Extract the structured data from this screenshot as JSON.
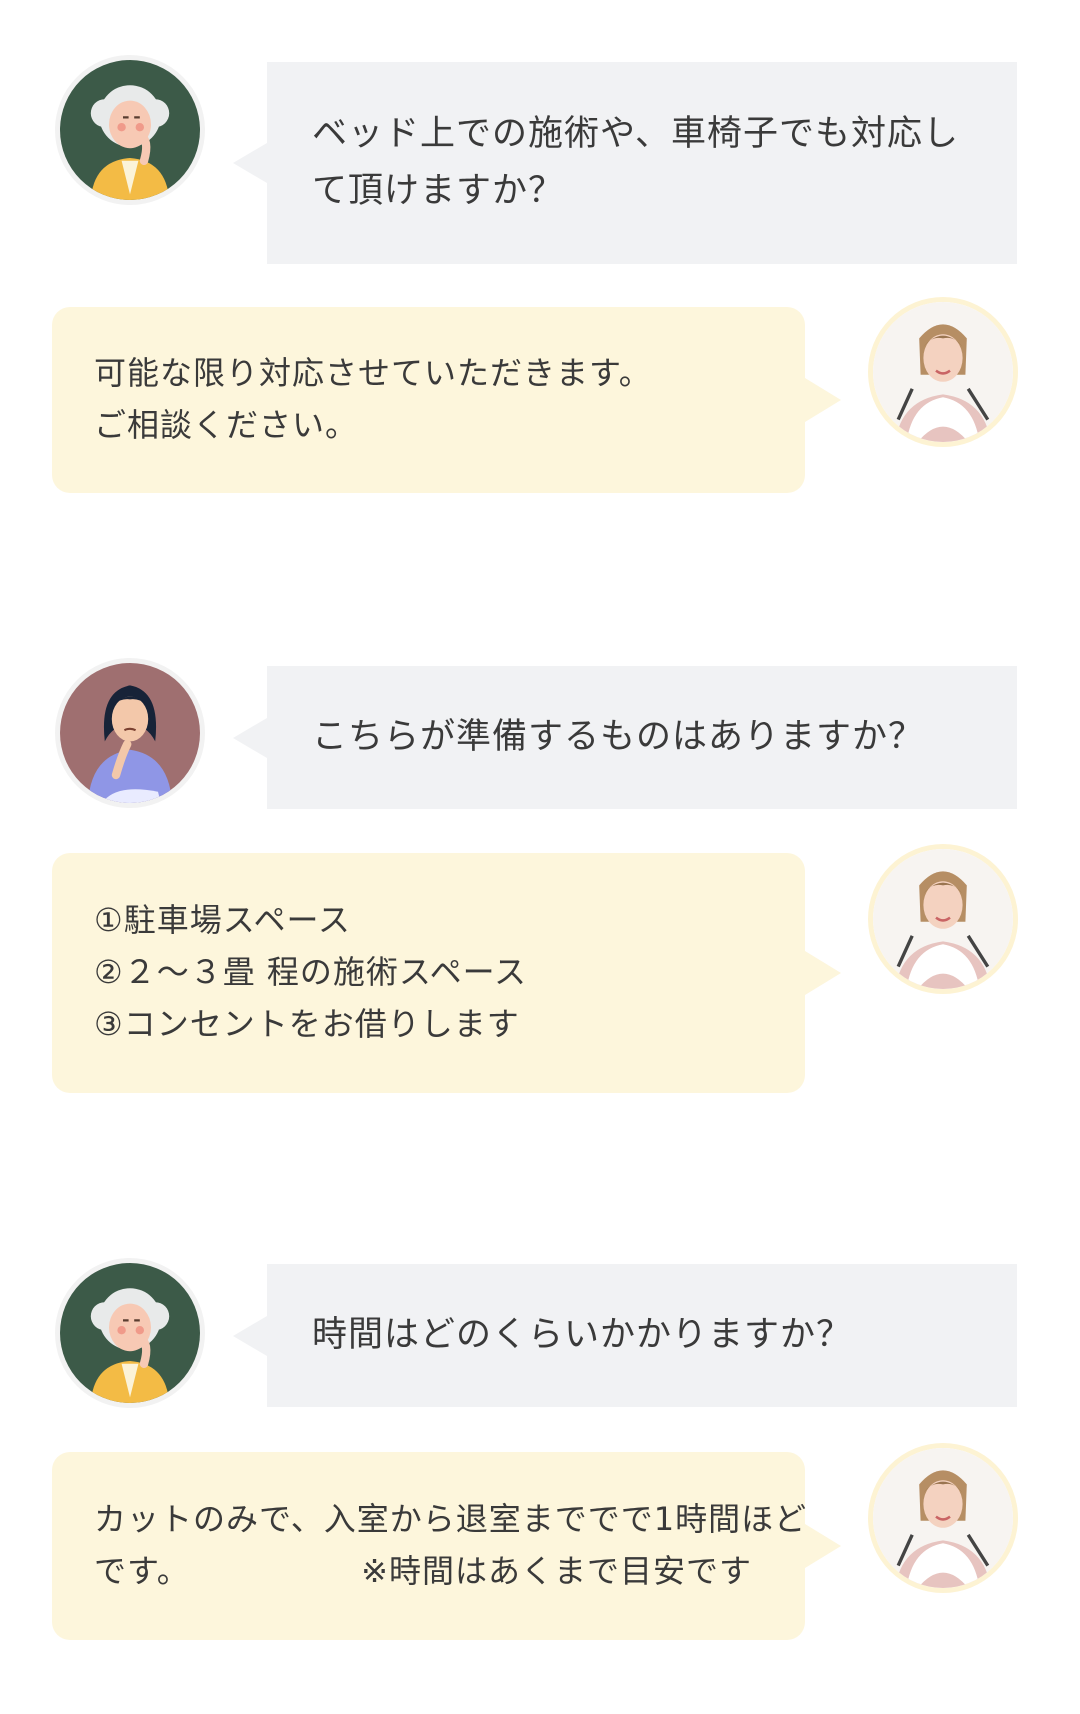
{
  "faqs": [
    {
      "question": [
        "ベッド上での施術や、車椅子でも対応し",
        "て頂けますか？"
      ],
      "answer": [
        "可能な限り対応させていただきます。",
        "ご相談ください。"
      ],
      "asker": "elderly-woman"
    },
    {
      "question": [
        "こちらが準備するものはありますか？"
      ],
      "answer": [
        "①駐車場スペース",
        "②２～３畳 程の施術スペース",
        "③コンセントをお借りします"
      ],
      "asker": "woman"
    },
    {
      "question": [
        "時間はどのくらいかかりますか？"
      ],
      "answer": [
        "カットのみで、入室から退室まででで1時間ほど",
        "です。　　　　　  ※時間はあくまで目安です"
      ],
      "asker": "elderly-woman"
    }
  ],
  "colors": {
    "question_bubble": "#f1f2f4",
    "answer_bubble": "#fdf6dc",
    "text": "#3a3a3a"
  },
  "icons": {
    "asker_1": "elderly-woman-avatar",
    "asker_2": "woman-avatar",
    "asker_3": "elderly-woman-avatar",
    "answerer": "stylist-avatar"
  }
}
